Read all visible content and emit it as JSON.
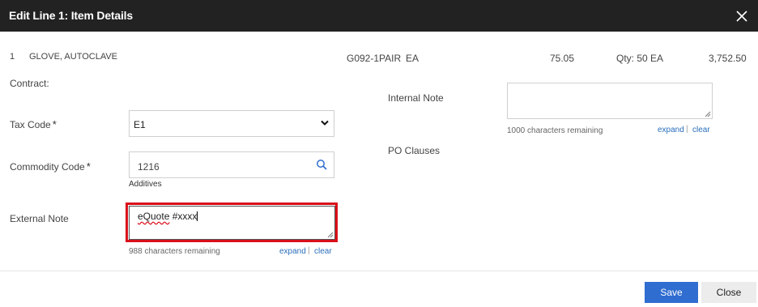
{
  "dialog": {
    "title": "Edit Line 1: Item Details",
    "close_icon": "close-icon"
  },
  "line": {
    "number": "1",
    "description": "GLOVE, AUTOCLAVE",
    "sku": "G092-1PAIR",
    "uom": "EA",
    "unit_price": "75.05",
    "qty": "Qty: 50 EA",
    "extended": "3,752.50"
  },
  "form": {
    "contract_label": "Contract:",
    "tax_code": {
      "label": "Tax Code",
      "required_mark": "*",
      "value": "E1"
    },
    "commodity_code": {
      "label": "Commodity Code",
      "required_mark": "*",
      "value": "1216",
      "helper": "Additives"
    },
    "external_note": {
      "label": "External Note",
      "value_word1": "eQuote",
      "value_rest": " #xxxx",
      "remaining": "988 characters remaining",
      "expand": "expand",
      "separator": "|",
      "clear": "clear"
    },
    "internal_note": {
      "label": "Internal Note",
      "remaining": "1000 characters remaining",
      "expand": "expand",
      "separator": "|",
      "clear": "clear"
    },
    "po_clauses_label": "PO Clauses"
  },
  "footer": {
    "save": "Save",
    "close": "Close"
  },
  "colors": {
    "header_bg": "#222222",
    "accent": "#2f6dd0",
    "highlight": "#d9101a"
  }
}
